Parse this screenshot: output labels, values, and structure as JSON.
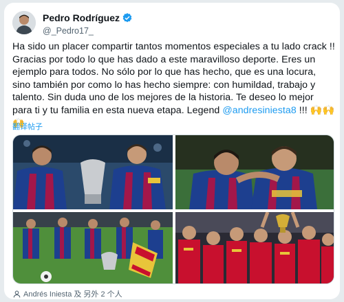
{
  "post": {
    "author_name": "Pedro Rodríguez",
    "author_handle": "@_Pedro17_",
    "text_before_mention": "Ha sido un placer compartir tantos momentos especiales a tu lado crack !! Gracias por todo lo que has dado a este maravilloso deporte. Eres un ejemplo para todos. No sólo por lo que has hecho, que es una locura, sino también por como lo has hecho siempre: con humildad, trabajo y talento. Sin duda uno de los mejores de la historia. Te deseo lo mejor para ti y tu familia en esta nueva etapa. Legend ",
    "mention": "@andresiniesta8",
    "text_after_mention": " !!! 🙌🙌🙌",
    "translate_label": "翻译帖子",
    "tagged_people": "Andrés Iniesta 及 另外 2 个人"
  },
  "colors": {
    "accent": "#1d9bf0",
    "barca_blue": "#1d3f8f",
    "barca_red": "#a3174a",
    "spain_red": "#c8102e"
  },
  "icons": {
    "verified": "verified-badge-icon",
    "tag": "person-tag-icon"
  }
}
